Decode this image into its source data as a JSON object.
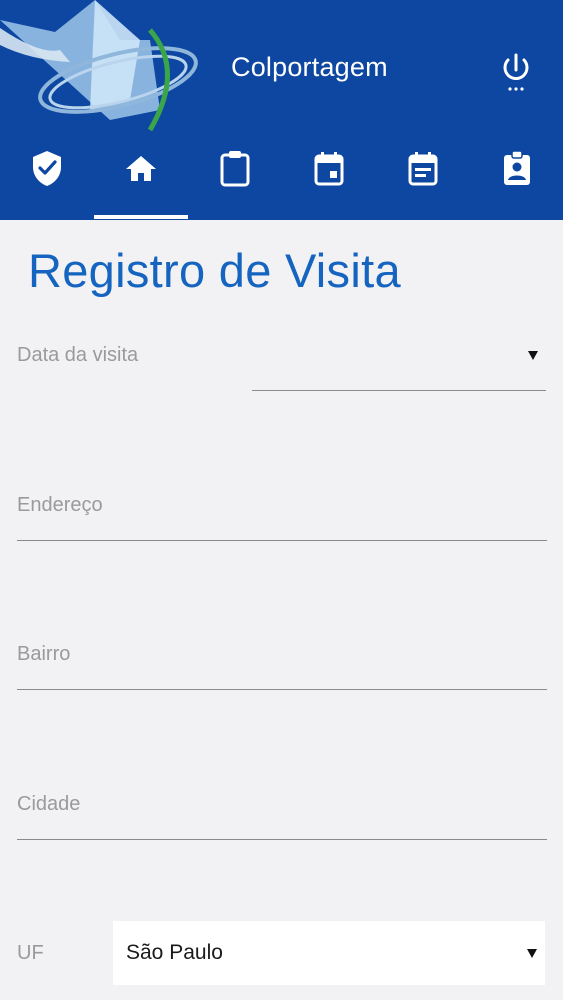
{
  "header": {
    "title": "Colportagem",
    "logo_icon": "book-globe-logo",
    "power_icon": "power-icon",
    "background_color": "#0d47a1"
  },
  "tabs": [
    {
      "icon": "verified-shield-icon"
    },
    {
      "icon": "home-icon",
      "active": true
    },
    {
      "icon": "clipboard-icon"
    },
    {
      "icon": "calendar-today-icon"
    },
    {
      "icon": "calendar-note-icon"
    },
    {
      "icon": "contact-badge-icon"
    }
  ],
  "form": {
    "title": "Registro de Visita",
    "title_color": "#1565c0",
    "fields": {
      "data_visita": {
        "label": "Data da visita",
        "value": ""
      },
      "endereco": {
        "label": "Endereço",
        "value": ""
      },
      "bairro": {
        "label": "Bairro",
        "value": ""
      },
      "cidade": {
        "label": "Cidade",
        "value": ""
      },
      "uf": {
        "label": "UF",
        "value": "São Paulo"
      }
    }
  }
}
